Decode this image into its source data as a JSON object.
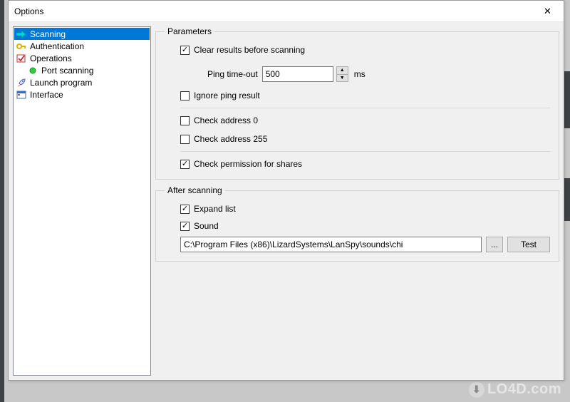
{
  "window": {
    "title": "Options"
  },
  "sidebar": {
    "items": [
      {
        "label": "Scanning",
        "icon": "arrow-right-icon",
        "selected": true
      },
      {
        "label": "Authentication",
        "icon": "key-icon",
        "selected": false
      },
      {
        "label": "Operations",
        "icon": "check-icon",
        "selected": false
      },
      {
        "label": "Port scanning",
        "icon": "dot-green-icon",
        "selected": false,
        "indent": true
      },
      {
        "label": "Launch program",
        "icon": "rocket-icon",
        "selected": false
      },
      {
        "label": "Interface",
        "icon": "window-icon",
        "selected": false
      }
    ]
  },
  "parameters": {
    "legend": "Parameters",
    "clear_results": {
      "label": "Clear results before scanning",
      "checked": true
    },
    "ping_timeout": {
      "label": "Ping time-out",
      "value": "500",
      "unit": "ms"
    },
    "ignore_ping": {
      "label": "Ignore ping result",
      "checked": false
    },
    "check_addr_0": {
      "label": "Check address 0",
      "checked": false
    },
    "check_addr_255": {
      "label": "Check address 255",
      "checked": false
    },
    "check_perm": {
      "label": "Check permission for shares",
      "checked": true
    }
  },
  "after_scanning": {
    "legend": "After scanning",
    "expand_list": {
      "label": "Expand list",
      "checked": true
    },
    "sound": {
      "label": "Sound",
      "checked": true
    },
    "sound_path": "C:\\Program Files (x86)\\LizardSystems\\LanSpy\\sounds\\chi",
    "browse_label": "...",
    "test_label": "Test"
  },
  "watermark": "LO4D.com"
}
